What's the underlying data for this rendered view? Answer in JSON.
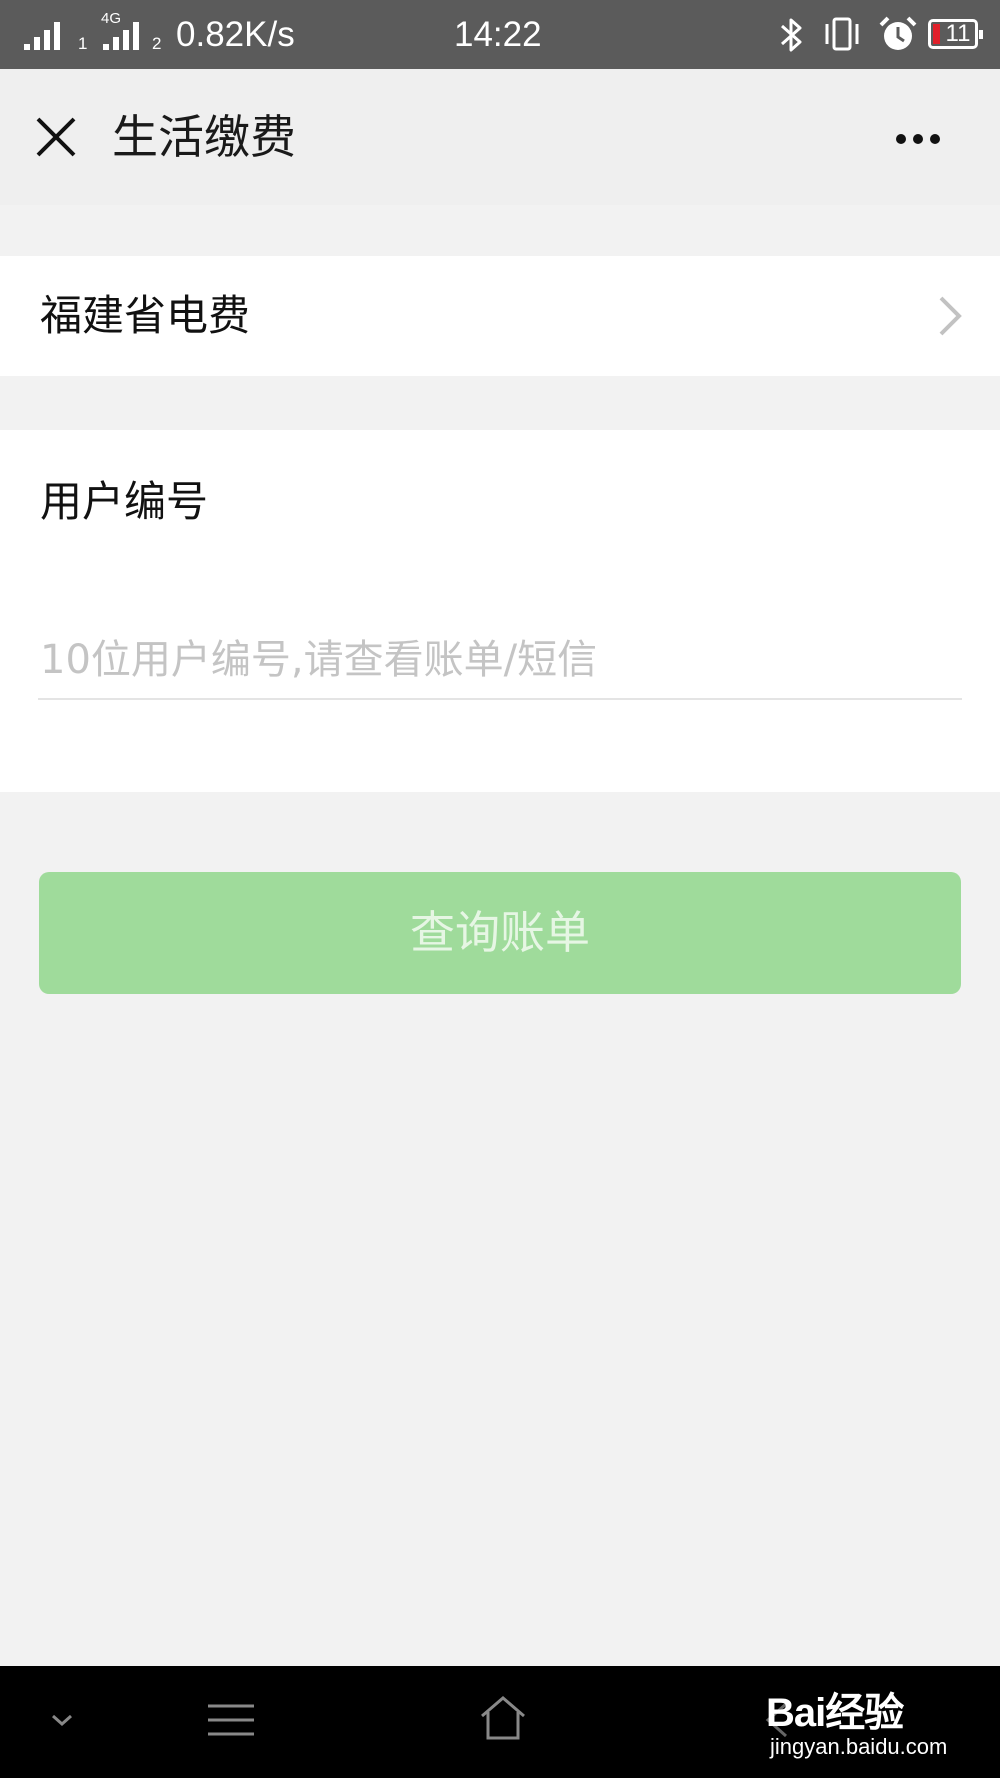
{
  "status_bar": {
    "sim1_label": "1",
    "sim2_network": "4G",
    "sim2_label": "2",
    "net_speed": "0.82K/s",
    "time": "14:22",
    "battery_level": "11",
    "icons": [
      "signal-icon",
      "bluetooth-icon",
      "vibrate-icon",
      "alarm-icon",
      "battery-icon"
    ]
  },
  "nav": {
    "title": "生活缴费",
    "close_icon": "close-icon",
    "more_icon": "more-icon"
  },
  "provider": {
    "label": "福建省电费",
    "icon": "chevron-right-icon"
  },
  "account_form": {
    "label": "用户编号",
    "value": "",
    "placeholder": "10位用户编号,请查看账单/短信"
  },
  "submit": {
    "label": "查询账单",
    "color": "#9fdb9b",
    "enabled": false
  },
  "system_nav": {
    "icons": [
      "collapse-icon",
      "menu-icon",
      "home-icon",
      "back-icon"
    ]
  },
  "watermark": {
    "logo": "Bai经验",
    "url": "jingyan.baidu.com"
  }
}
